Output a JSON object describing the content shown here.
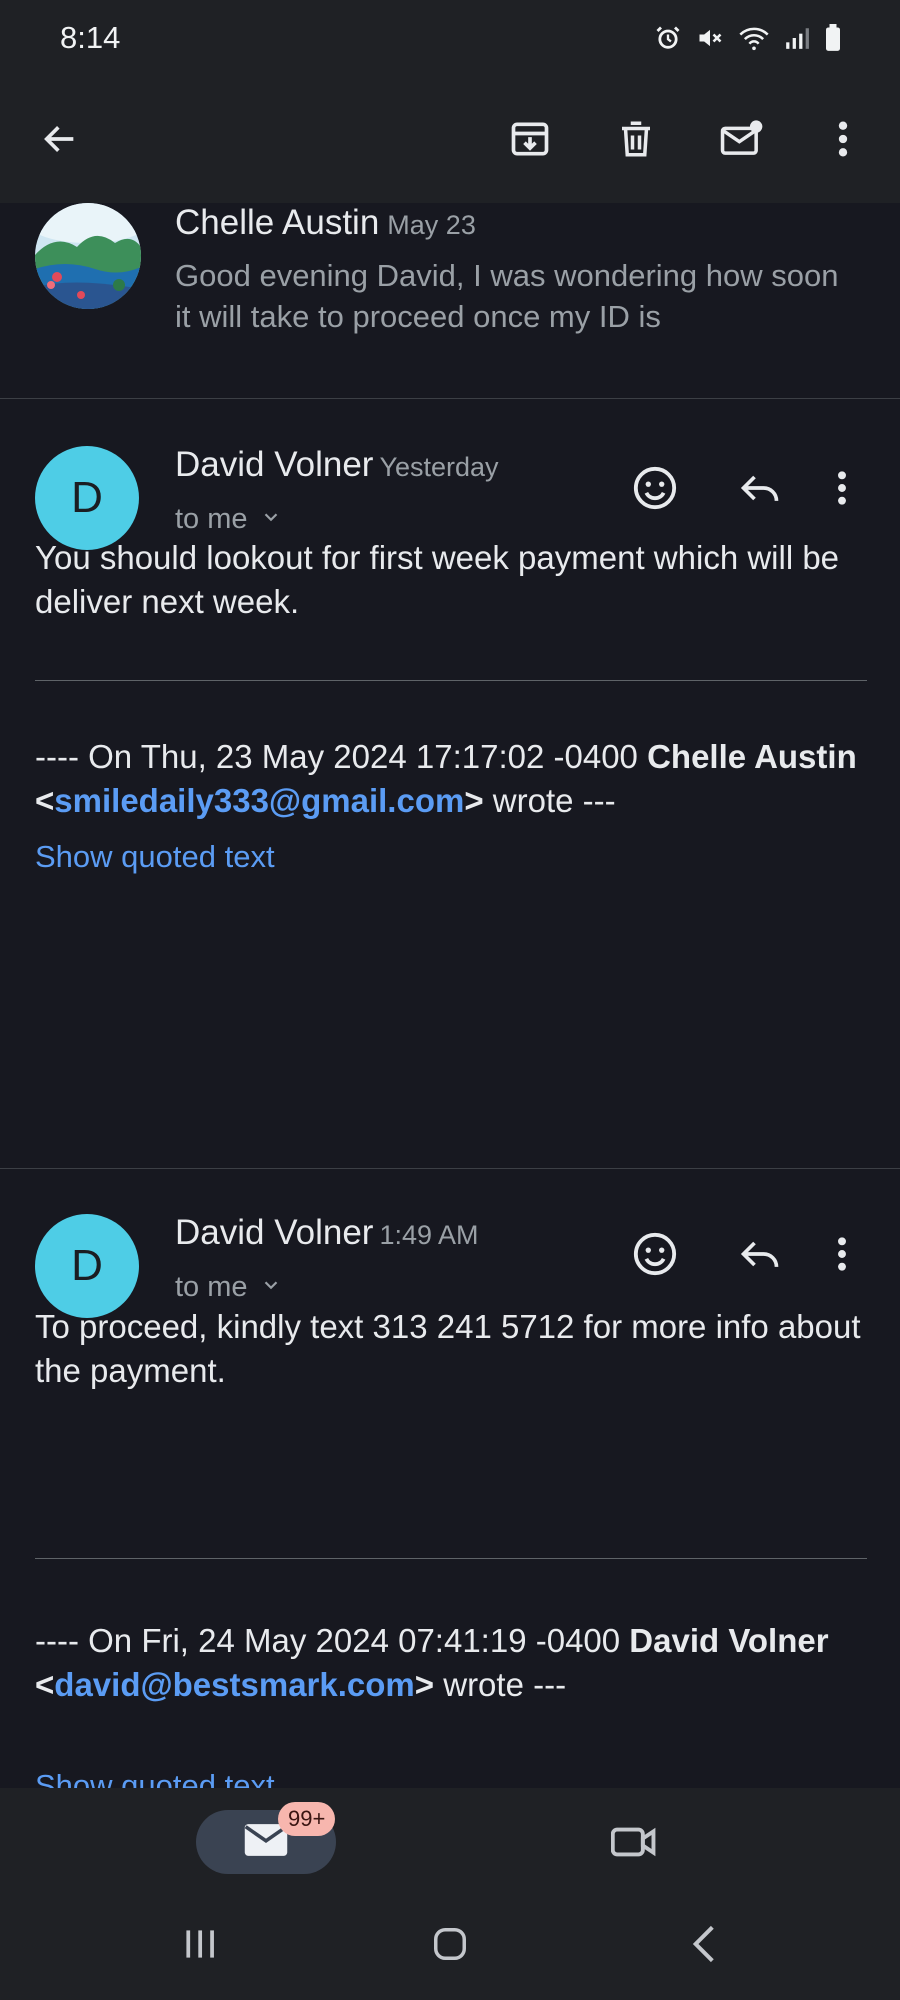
{
  "status_bar": {
    "time": "8:14",
    "icons": [
      "alarm-icon",
      "mute-icon",
      "wifi-icon",
      "signal-icon",
      "battery-icon"
    ]
  },
  "app_bar": {
    "actions": [
      "back-icon",
      "archive-icon",
      "delete-icon",
      "mark-unread-icon",
      "more-vert-icon"
    ]
  },
  "thread": {
    "collapsed_message": {
      "sender": "Chelle Austin",
      "date": "May 23",
      "snippet": "Good evening David, I was wondering how soon it will take to proceed once my ID is"
    },
    "messages": [
      {
        "avatar_letter": "D",
        "sender": "David Volner",
        "time": "Yesterday",
        "recipient": "to me",
        "body": "You should lookout for first week payment which will be deliver next week.",
        "quote_prefix": "---- On Thu, 23 May 2024 17:17:02 -0400 ",
        "quote_name": "Chelle Austin",
        "quote_lt": " <",
        "quote_email": "smiledaily333@gmail.com",
        "quote_gt": ">",
        "quote_suffix": " wrote ---",
        "show_quoted": "Show quoted text"
      },
      {
        "avatar_letter": "D",
        "sender": "David Volner",
        "time": "1:49 AM",
        "recipient": "to me",
        "body": "To proceed, kindly text 313 241 5712 for more info about the payment.",
        "quote_prefix": "---- On Fri, 24 May 2024 07:41:19 -0400 ",
        "quote_name": "David Volner",
        "quote_lt": " <",
        "quote_email": "david@bestsmark.com",
        "quote_gt": ">",
        "quote_suffix": " wrote ---",
        "show_quoted": "Show quoted text"
      }
    ]
  },
  "bottom_nav": {
    "mail_badge": "99+",
    "items": [
      "mail-icon",
      "video-icon"
    ]
  },
  "system_nav": [
    "recents-icon",
    "home-icon",
    "back-nav-icon"
  ],
  "colors": {
    "background": "#171820",
    "bar": "#1f2125",
    "accent_link": "#5b9cf4",
    "avatar": "#4ecde6",
    "badge": "#f7b6ae"
  }
}
